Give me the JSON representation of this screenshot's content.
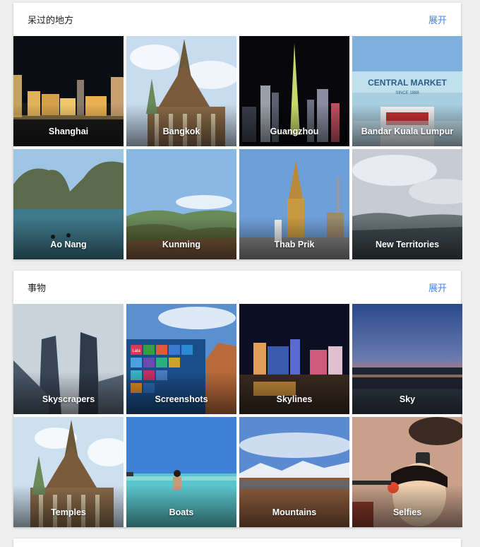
{
  "sections": [
    {
      "title": "呆过的地方",
      "expand_label": "展开",
      "tiles": [
        {
          "label": "Shanghai"
        },
        {
          "label": "Bangkok"
        },
        {
          "label": "Guangzhou"
        },
        {
          "label": "Bandar Kuala Lumpur",
          "sign_text": "CENTRAL MARKET",
          "sign_subtext": "SINCE 1888"
        },
        {
          "label": "Ao Nang"
        },
        {
          "label": "Kunming"
        },
        {
          "label": "Thab Prik"
        },
        {
          "label": "New Territories"
        }
      ]
    },
    {
      "title": "事物",
      "expand_label": "展开",
      "tiles": [
        {
          "label": "Skyscrapers"
        },
        {
          "label": "Screenshots",
          "tile_text": "Lala"
        },
        {
          "label": "Skylines"
        },
        {
          "label": "Sky"
        },
        {
          "label": "Temples"
        },
        {
          "label": "Boats"
        },
        {
          "label": "Mountains"
        },
        {
          "label": "Selfies"
        }
      ]
    }
  ],
  "colors": {
    "link": "#4285f4",
    "background": "#eeeeee",
    "card": "#ffffff"
  }
}
